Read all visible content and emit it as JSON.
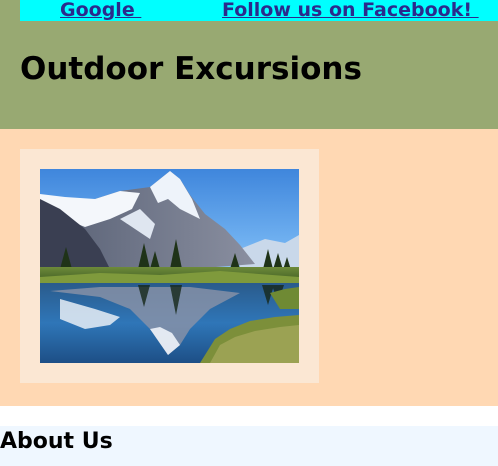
{
  "nav": {
    "links": [
      {
        "label": "Google "
      },
      {
        "label": "Follow us on Facebook! "
      }
    ]
  },
  "header": {
    "title": "Outdoor Excursions"
  },
  "hero": {
    "image": "mountain-lake-photo"
  },
  "about": {
    "heading": "About Us"
  },
  "colors": {
    "nav_background": "#00ffff",
    "link": "#2b2a8c",
    "header_background": "#98a972",
    "hero_background": "#ffd8b3",
    "frame_background": "#fbe7d3",
    "about_background": "#eff7ff"
  }
}
